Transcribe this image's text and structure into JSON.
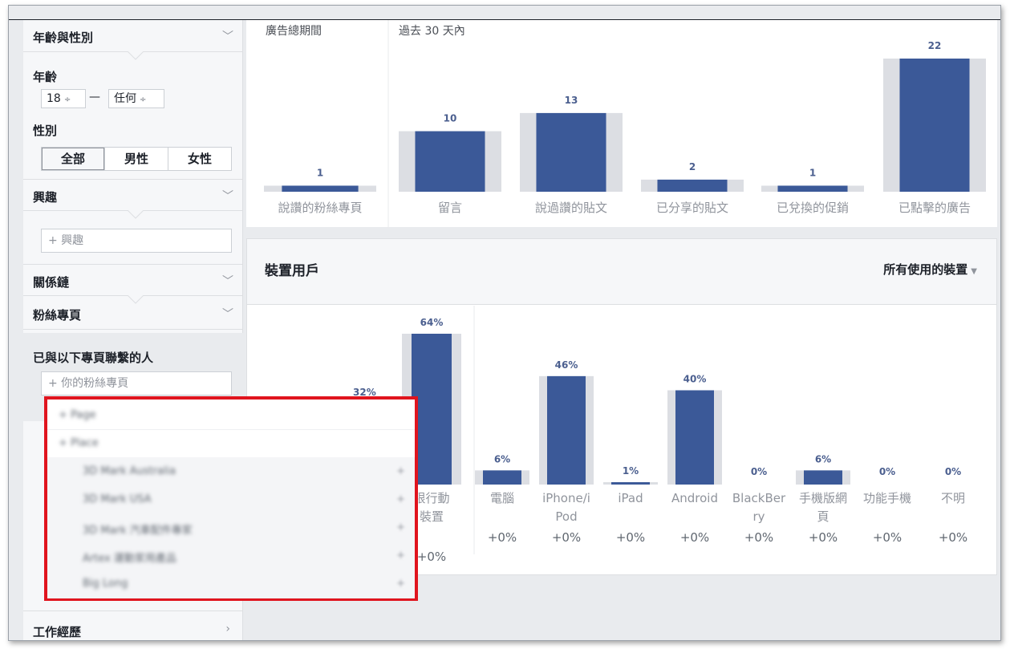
{
  "sidebar": {
    "age_gender_title": "年齡與性別",
    "age_label": "年齡",
    "age_min": "18",
    "age_dash": "—",
    "age_max": "任何",
    "gender_label": "性別",
    "gender_options": [
      "全部",
      "男性",
      "女性"
    ],
    "gender_selected": "全部",
    "interests_title": "興趣",
    "interests_placeholder": "+ 興趣",
    "relationship_title": "關係鏈",
    "pages_title": "粉絲專頁",
    "connected_label": "已與以下專頁聯繫的人",
    "connected_placeholder": "+ 你的粉絲專頁",
    "work_title": "工作經歷",
    "chevron_down": "﹀",
    "chevron_right": "›",
    "select_arrow": "÷"
  },
  "popup": {
    "rows": [
      {
        "label": "Page",
        "indent": false
      },
      {
        "label": "Place",
        "indent": false
      },
      {
        "label": "3D Mark Australia",
        "indent": true
      },
      {
        "label": "3D Mark USA",
        "indent": true
      },
      {
        "label": "3D Mark 汽車配件專家",
        "indent": true
      },
      {
        "label": "Artex 運動家用產品",
        "indent": true
      },
      {
        "label": "Big Long",
        "indent": true
      }
    ],
    "add_glyph": "+"
  },
  "activity": {
    "left_header": "廣告總期間",
    "right_header": "過去 30 天內",
    "colors": {
      "bar": "#3b5998",
      "track": "#dcdee3",
      "value_text": "#4b5f8f",
      "label_text": "#90949c"
    }
  },
  "devices": {
    "title": "裝置用戶",
    "dropdown_label": "所有使用的裝置",
    "partial_left_pct": "32%",
    "colors": {
      "bar": "#3b5998",
      "track": "#dcdee3"
    }
  },
  "chart_data": [
    {
      "type": "bar",
      "title": "",
      "groups": [
        "廣告總期間",
        "過去 30 天內"
      ],
      "categories": [
        "說讚的粉絲專頁",
        "留言",
        "說過讚的貼文",
        "已分享的貼文",
        "已兌換的促銷",
        "已點擊的廣告"
      ],
      "values": [
        1,
        10,
        13,
        2,
        1,
        22
      ],
      "value_labels": [
        "1",
        "10",
        "13",
        "2",
        "1",
        "22"
      ],
      "ylim": [
        0,
        22
      ]
    },
    {
      "type": "bar",
      "title": "",
      "categories": [
        "限行動裝置",
        "電腦",
        "iPhone/iPod",
        "iPad",
        "Android",
        "BlackBerry",
        "手機版網頁",
        "功能手機",
        "不明"
      ],
      "category_lines": [
        [
          "限行動",
          "裝置"
        ],
        [
          "電腦"
        ],
        [
          "iPhone/i",
          "Pod"
        ],
        [
          "iPad"
        ],
        [
          "Android"
        ],
        [
          "BlackBer",
          "ry"
        ],
        [
          "手機版網",
          "頁"
        ],
        [
          "功能手機"
        ],
        [
          "不明"
        ]
      ],
      "values": [
        64,
        6,
        46,
        1,
        40,
        0,
        6,
        0,
        0
      ],
      "value_labels": [
        "64%",
        "6%",
        "46%",
        "1%",
        "40%",
        "0%",
        "6%",
        "0%",
        "0%"
      ],
      "changes": [
        "+0%",
        "+0%",
        "+0%",
        "+0%",
        "+0%",
        "+0%",
        "+0%",
        "+0%",
        "+0%"
      ],
      "ylim": [
        0,
        64
      ]
    }
  ]
}
